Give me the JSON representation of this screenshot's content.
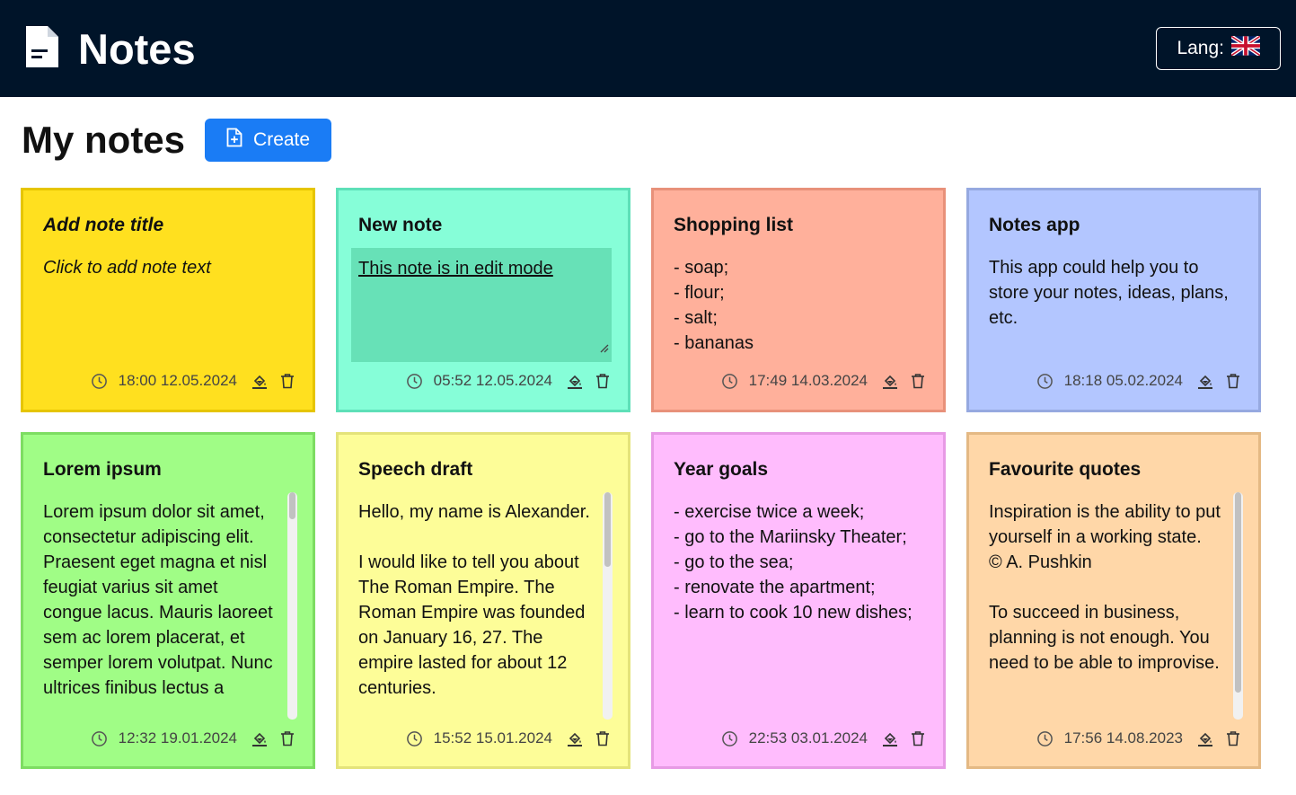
{
  "app": {
    "title": "Notes",
    "lang_label": "Lang:"
  },
  "page": {
    "title": "My notes",
    "create_label": "Create"
  },
  "notes": [
    {
      "title": "Add note title",
      "text": "Click to add note text",
      "time": "18:00",
      "date": "12.05.2024",
      "bg": "#ffe01f",
      "border": "#e6c500",
      "placeholder": true
    },
    {
      "title": "New note",
      "text": "This note is in edit mode",
      "time": "05:52",
      "date": "12.05.2024",
      "bg": "#86fed8",
      "border": "#5ee0b8",
      "editing": true
    },
    {
      "title": "Shopping list",
      "text": "- soap;\n- flour;\n- salt;\n- bananas",
      "time": "17:49",
      "date": "14.03.2024",
      "bg": "#ffb09b",
      "border": "#e8917a"
    },
    {
      "title": "Notes app",
      "text": "This app could help you to store your notes, ideas, plans, etc.",
      "time": "18:18",
      "date": "05.02.2024",
      "bg": "#b3c6ff",
      "border": "#96a9e0"
    },
    {
      "title": "Lorem ipsum",
      "text": "Lorem ipsum dolor sit amet, consectetur adipiscing elit. Praesent eget magna et nisl feugiat varius sit amet congue lacus. Mauris laoreet sem ac lorem placerat, et semper lorem volutpat. Nunc ultrices finibus lectus a ornare. Quisque quis augue",
      "time": "12:32",
      "date": "19.01.2024",
      "bg": "#a0fd86",
      "border": "#7ddd62",
      "scroll": true,
      "thumb_top": 0,
      "thumb_height": 0.12
    },
    {
      "title": "Speech draft",
      "text": "Hello, my name is Alexander.\n\nI would like to tell you about The Roman Empire. The Roman Empire was founded on January 16, 27. The empire lasted for about 12 centuries.",
      "time": "15:52",
      "date": "15.01.2024",
      "bg": "#fdfd98",
      "border": "#e4e37a",
      "scroll": true,
      "thumb_top": 0,
      "thumb_height": 0.33
    },
    {
      "title": "Year goals",
      "text": "- exercise twice a week;\n- go to the Mariinsky Theater;\n- go to the sea;\n- renovate the apartment;\n- learn to cook 10 new dishes;",
      "time": "22:53",
      "date": "03.01.2024",
      "bg": "#ffbcfd",
      "border": "#e79ae5"
    },
    {
      "title": "Favourite quotes",
      "text": "Inspiration is the ability to put yourself in a working state.\n© A. Pushkin\n\nTo succeed in business, planning is not enough. You need to be able to improvise.",
      "time": "17:56",
      "date": "14.08.2023",
      "bg": "#ffd7a8",
      "border": "#e4b984",
      "scroll": true,
      "thumb_top": 0,
      "thumb_height": 0.88
    }
  ],
  "icons": {
    "logo": "document-icon",
    "flag": "uk-flag-icon",
    "create": "file-plus-icon",
    "clock": "clock-icon",
    "color": "paint-bucket-icon",
    "delete": "trash-icon"
  }
}
